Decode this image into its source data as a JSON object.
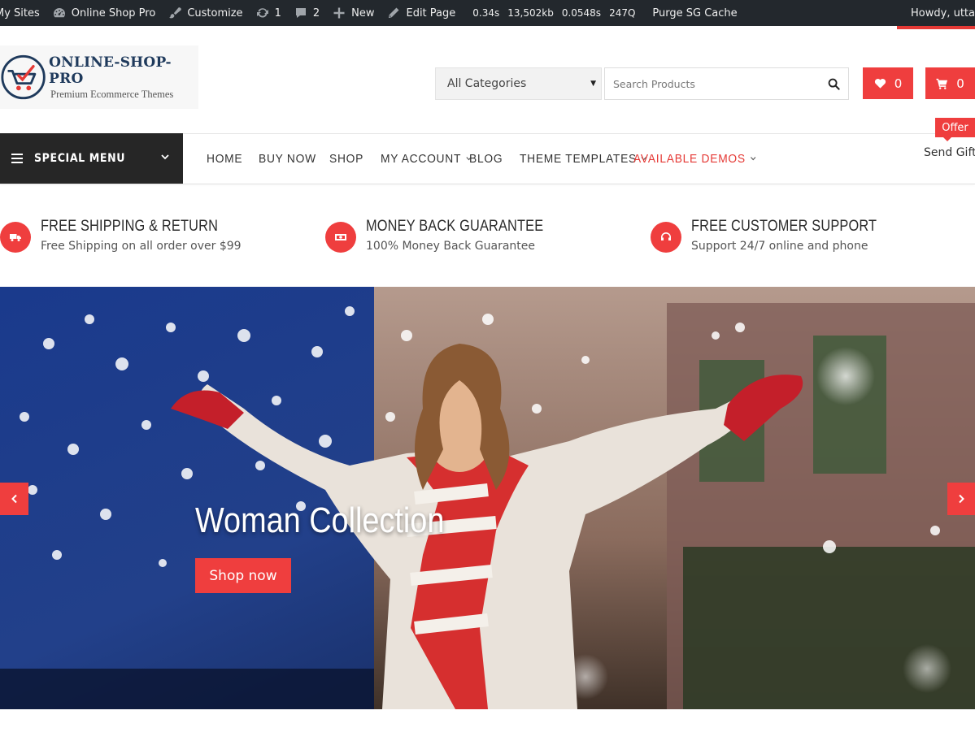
{
  "admin_bar": {
    "my_sites": "My Sites",
    "site_name": "Online Shop Pro",
    "customize": "Customize",
    "updates_count": "1",
    "comments_count": "2",
    "new": "New",
    "edit_page": "Edit Page",
    "stats": [
      "0.34s",
      "13,502kb",
      "0.0548s",
      "247Q"
    ],
    "purge_cache": "Purge SG Cache",
    "howdy": "Howdy, utta"
  },
  "header": {
    "logo_name": "ONLINE-SHOP-PRO",
    "logo_tagline": "Premium Ecommerce Themes",
    "category_select": "All Categories",
    "search_placeholder": "Search Products",
    "wishlist_count": "0",
    "cart_count": "0"
  },
  "nav": {
    "special_menu": "SPECIAL MENU",
    "items": [
      "HOME",
      "BUY NOW",
      "SHOP",
      "MY ACCOUNT",
      "BLOG",
      "THEME TEMPLATES",
      "AVAILABLE DEMOS"
    ],
    "offer_badge": "Offer",
    "send_gift": "Send Gift"
  },
  "features": [
    {
      "title": "FREE SHIPPING & RETURN",
      "subtitle": "Free Shipping on all order over $99",
      "icon": "truck-icon"
    },
    {
      "title": "MONEY BACK GUARANTEE",
      "subtitle": "100% Money Back Guarantee",
      "icon": "money-icon"
    },
    {
      "title": "FREE CUSTOMER SUPPORT",
      "subtitle": "Support 24/7 online and phone",
      "icon": "headset-icon"
    }
  ],
  "hero": {
    "title": "Woman Collection",
    "button": "Shop now"
  },
  "colors": {
    "accent": "#ef3e3e",
    "admin_bar": "#23282d",
    "special_menu": "#262626"
  }
}
